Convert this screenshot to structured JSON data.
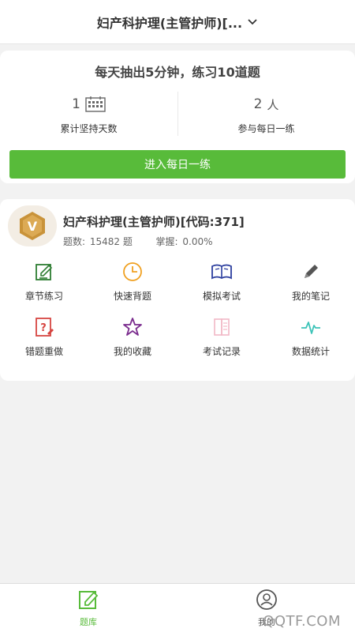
{
  "header": {
    "title": "妇产科护理(主管护师)[..."
  },
  "daily": {
    "headline": "每天抽出5分钟，练习10道题",
    "days_value": "1",
    "days_label": "累计坚持天数",
    "people_value": "2",
    "people_unit": "人",
    "people_label": "参与每日一练",
    "enter_label": "进入每日一练",
    "accent": "#58bb3a"
  },
  "bank": {
    "badge_letter": "V",
    "name": "妇产科护理(主管护师)[代码:371]",
    "count_label": "题数:",
    "count_value": "15482 题",
    "mastery_label": "掌握:",
    "mastery_value": "0.00%",
    "features": [
      {
        "label": "章节练习",
        "icon": "edit-icon",
        "color": "#2e7d32"
      },
      {
        "label": "快速背题",
        "icon": "clock-icon",
        "color": "#f0a020"
      },
      {
        "label": "模拟考试",
        "icon": "book-icon",
        "color": "#2c3e9e"
      },
      {
        "label": "我的笔记",
        "icon": "pencil-icon",
        "color": "#555555"
      },
      {
        "label": "错题重做",
        "icon": "question-doc-icon",
        "color": "#d64541"
      },
      {
        "label": "我的收藏",
        "icon": "star-icon",
        "color": "#7b2d8e"
      },
      {
        "label": "考试记录",
        "icon": "record-book-icon",
        "color": "#f2b8c6"
      },
      {
        "label": "数据统计",
        "icon": "pulse-icon",
        "color": "#3cc3b8"
      }
    ]
  },
  "tabs": [
    {
      "label": "题库",
      "icon": "edit-tab-icon"
    },
    {
      "label": "我的",
      "icon": "user-icon"
    }
  ],
  "watermark": "QQTF.COM"
}
